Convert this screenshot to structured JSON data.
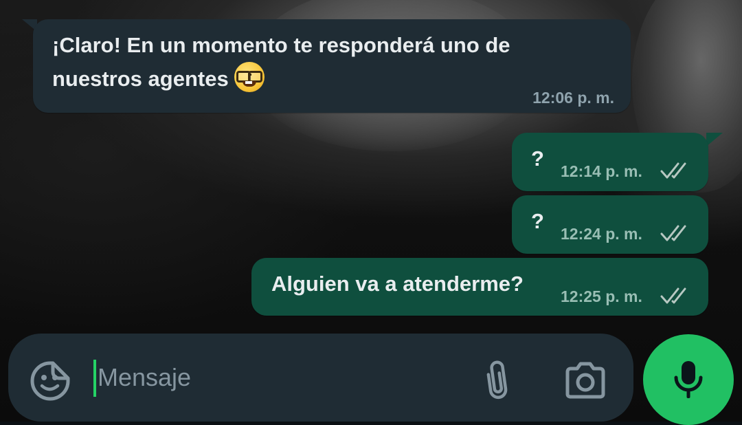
{
  "messages": [
    {
      "direction": "incoming",
      "text_line1": "¡Claro! En un momento te responderá uno de",
      "text_line2": "nuestros agentes",
      "emoji": "nerd-face-emoji",
      "time": "12:06 p. m."
    },
    {
      "direction": "outgoing",
      "text": "?",
      "time": "12:14 p. m.",
      "status": "read-double-check"
    },
    {
      "direction": "outgoing",
      "text": "?",
      "time": "12:24 p. m.",
      "status": "read-double-check"
    },
    {
      "direction": "outgoing",
      "text": "Alguien va a atenderme?",
      "time": "12:25 p. m.",
      "status": "read-double-check"
    }
  ],
  "composer": {
    "placeholder": "Mensaje",
    "value": "",
    "icons": {
      "sticker": "sticker-icon",
      "attach": "paperclip-icon",
      "camera": "camera-icon",
      "mic": "microphone-icon"
    }
  },
  "colors": {
    "incoming_bubble": "#1f2c34",
    "outgoing_bubble": "#005c4b",
    "accent": "#21c063",
    "text": "#e9edef",
    "muted": "#8696a0"
  }
}
